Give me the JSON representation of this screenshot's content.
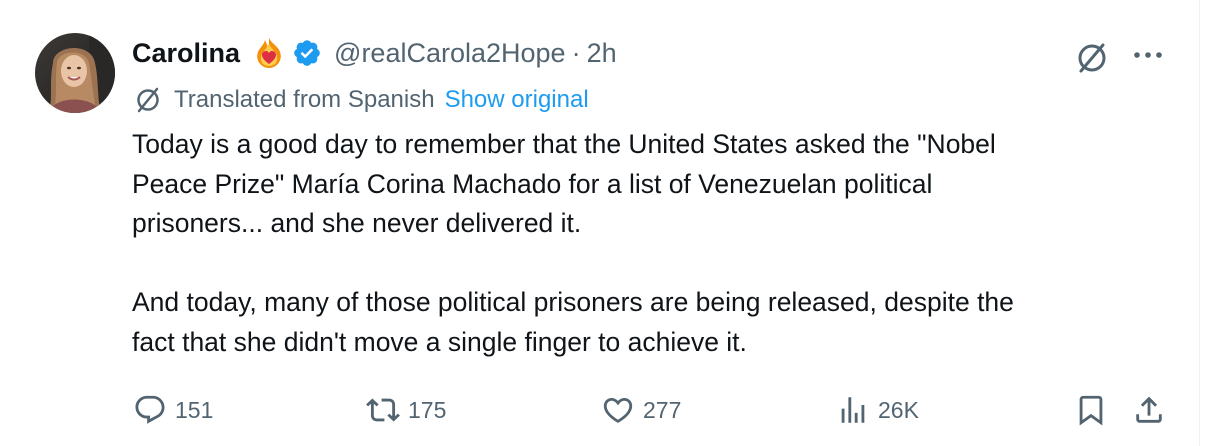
{
  "author": {
    "display_name": "Carolina",
    "handle": "@realCarola2Hope",
    "separator": "·",
    "time": "2h",
    "emoji_icon": "heart-on-fire-icon",
    "verified_icon": "verified-badge-icon",
    "verified_color": "#1d9bf0"
  },
  "translation": {
    "label": "Translated from Spanish",
    "show_original_label": "Show original",
    "icon": "grok-translate-icon"
  },
  "tweet": {
    "text": "Today is a good day to remember that the United States asked the \"Nobel\nPeace Prize\" María Corina Machado for a list of Venezuelan political\nprisoners... and she never delivered it.\n\nAnd today, many of those political prisoners are being released, despite the\nfact that she didn't move a single finger to achieve it."
  },
  "header_actions": {
    "grok_icon": "grok-icon",
    "more_icon": "more-icon"
  },
  "metrics": {
    "replies": "151",
    "reposts": "175",
    "likes": "277",
    "views": "26K"
  },
  "action_icons": {
    "reply": "reply-icon",
    "repost": "repost-icon",
    "like": "heart-icon",
    "views": "views-icon",
    "bookmark": "bookmark-icon",
    "share": "share-icon"
  },
  "colors": {
    "text_primary": "#0f1419",
    "text_secondary": "#536471",
    "link": "#1d9bf0"
  }
}
